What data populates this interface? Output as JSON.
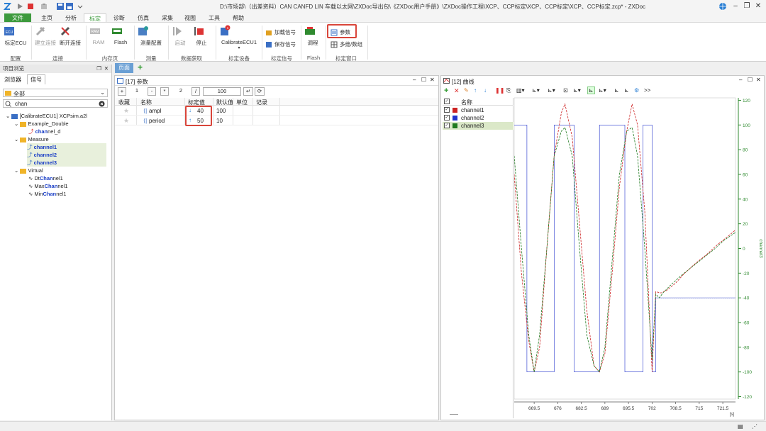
{
  "window": {
    "title": "D:\\市场部\\（出差资料）CAN CANFD LIN 车载以太网\\ZXDoc导出包\\《ZXDoc用户手册》\\ZXDoc操作工程\\XCP、CCP标定\\XCP、CCP标定\\XCP、CCP标定.zcp* - ZXDoc"
  },
  "ribbon": {
    "tabs": [
      "文件",
      "主页",
      "分析",
      "标定",
      "诊断",
      "仿真",
      "采集",
      "视图",
      "工具",
      "帮助"
    ],
    "active_tab": "标定",
    "groups": {
      "config": {
        "label": "配置",
        "buttons": [
          "标定ECU"
        ]
      },
      "connect": {
        "label": "连接",
        "buttons": [
          "建立连接",
          "断开连接"
        ]
      },
      "mempage": {
        "label": "内存页",
        "buttons": [
          "RAM",
          "Flash"
        ]
      },
      "measure": {
        "label": "测量",
        "buttons": [
          "测量配置"
        ]
      },
      "acquire": {
        "label": "数据获取",
        "buttons": [
          "启动",
          "停止"
        ]
      },
      "device": {
        "label": "标定设备",
        "buttons": [
          "CalibrateECU1"
        ]
      },
      "signal": {
        "label": "标定信号",
        "buttons": [
          "加载信号",
          "保存信号"
        ]
      },
      "flash": {
        "label": "Flash",
        "buttons": [
          "调程"
        ]
      },
      "window": {
        "label": "标定窗口",
        "buttons": [
          "参数",
          "多维/数组"
        ]
      }
    }
  },
  "doc_tabs": {
    "page": "页面",
    "add": "+"
  },
  "project_browser": {
    "title": "项目浏览",
    "tabs": [
      "浏览器",
      "信号"
    ],
    "filter_value": "全部",
    "search_value": "chan",
    "root": "[CalibrateECU1] XCPsim.a2l",
    "groups": [
      {
        "name": "Example_Double",
        "items": [
          {
            "pre": "",
            "hit": "chan",
            "post": "nel_d"
          }
        ]
      },
      {
        "name": "Measure",
        "items": [
          {
            "pre": "",
            "hit": "channel1",
            "post": ""
          },
          {
            "pre": "",
            "hit": "channel2",
            "post": ""
          },
          {
            "pre": "",
            "hit": "channel3",
            "post": ""
          }
        ]
      },
      {
        "name": "Virtual",
        "items": [
          {
            "pre": "Dt",
            "hit": "Chan",
            "post": "nel1"
          },
          {
            "pre": "Max",
            "hit": "Chan",
            "post": "nel1"
          },
          {
            "pre": "Min",
            "hit": "Chan",
            "post": "nel1"
          }
        ]
      }
    ]
  },
  "params_window": {
    "title": "[17] 参数",
    "toolbar": {
      "plus": "+",
      "step": "1",
      "minus": "-",
      "mul": "*",
      "factor": "2",
      "div": "/",
      "value": "100"
    },
    "columns": [
      "收藏",
      "名称",
      "标定值",
      "默认值",
      "单位",
      "记录"
    ],
    "rows": [
      {
        "name": "ampl",
        "value": "40",
        "default": "100",
        "unit": "",
        "record": ""
      },
      {
        "name": "period",
        "value": "50",
        "default": "10",
        "unit": "",
        "record": ""
      }
    ]
  },
  "curve_window": {
    "title": "[12] 曲线",
    "more": ">>",
    "legend_header": "名称",
    "channels": [
      {
        "name": "channel1",
        "color": "#cc2222"
      },
      {
        "name": "channel2",
        "color": "#2233cc"
      },
      {
        "name": "channel3",
        "color": "#1f7a1f"
      }
    ]
  },
  "chart_data": {
    "type": "line",
    "xlabel": "[s]",
    "ylabel": "channel3",
    "x_ticks": [
      "669.5",
      "676",
      "682.5",
      "689",
      "695.5",
      "702",
      "708.5",
      "715",
      "721.5"
    ],
    "y_ticks": [
      "120",
      "100",
      "80",
      "60",
      "40",
      "20",
      "0",
      "-20",
      "-40",
      "-60",
      "-80",
      "-100",
      "-120"
    ],
    "xlim": [
      664.0,
      725.0
    ],
    "ylim": [
      -122,
      122
    ],
    "series": [
      {
        "name": "channel1",
        "x": [
          664.0,
          666.0,
          668.0,
          669.5,
          671.0,
          673.0,
          675.0,
          677.0,
          678.0,
          680.0,
          682.0,
          684.0,
          686.0,
          687.5,
          689.0,
          691.0,
          693.0,
          695.0,
          696.5,
          698.0,
          700.0,
          702.0,
          703.0,
          704.5,
          706.0,
          708.5,
          711.0,
          714.0,
          717.0,
          720.0,
          723.0,
          725.0
        ],
        "y": [
          60,
          -20,
          -75,
          -100,
          -80,
          0,
          75,
          110,
          117,
          90,
          20,
          -50,
          -95,
          -100,
          -85,
          -20,
          50,
          95,
          117,
          100,
          30,
          -100,
          -35,
          -36,
          -34,
          -28,
          -20,
          -12,
          -5,
          3,
          10,
          15
        ]
      },
      {
        "name": "channel2",
        "x": [
          664.0,
          667.5,
          667.5,
          675.0,
          675.0,
          680.5,
          680.5,
          687.5,
          687.5,
          694.5,
          694.5,
          699.5,
          699.5,
          702.0,
          702.0,
          703.0,
          703.0,
          725.0
        ],
        "y": [
          100,
          100,
          -100,
          -100,
          100,
          100,
          -100,
          -100,
          100,
          100,
          -100,
          -100,
          100,
          100,
          -100,
          -100,
          -40,
          -40
        ]
      },
      {
        "name": "channel3",
        "x": [
          664.0,
          666.0,
          668.0,
          669.5,
          671.0,
          673.0,
          675.0,
          677.0,
          678.0,
          680.0,
          682.0,
          684.0,
          686.0,
          687.5,
          689.0,
          691.0,
          693.0,
          695.0,
          696.5,
          698.0,
          700.0,
          702.0,
          703.0,
          704.0,
          705.0,
          707.0,
          710.0,
          713.0,
          716.0,
          719.0,
          722.0,
          725.0
        ],
        "y": [
          75,
          0,
          -70,
          -100,
          -70,
          0,
          75,
          95,
          98,
          75,
          0,
          -70,
          -95,
          -100,
          -80,
          -10,
          60,
          95,
          98,
          75,
          0,
          -90,
          -37,
          -40,
          -36,
          -30,
          -22,
          -15,
          -8,
          -1,
          7,
          13
        ]
      }
    ],
    "grid": false,
    "legend": "left"
  },
  "icons": {
    "star": "star-icon",
    "down": "arrow-down-icon",
    "up": "arrow-up-icon"
  }
}
